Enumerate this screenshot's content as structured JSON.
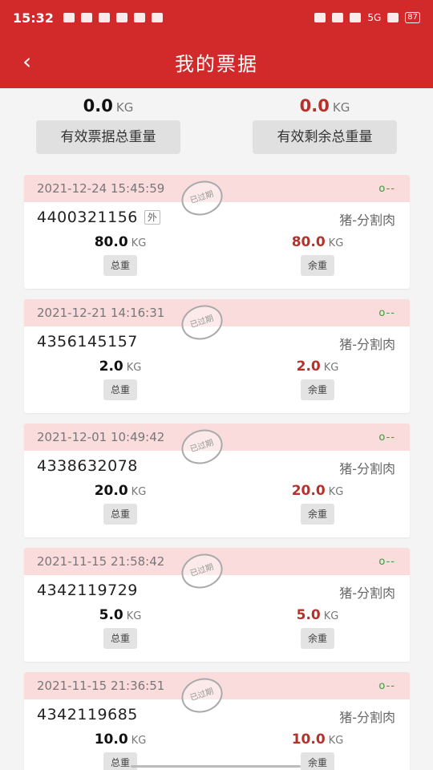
{
  "status_bar": {
    "time": "15:32",
    "signal": "5G",
    "battery": "87"
  },
  "header": {
    "title": "我的票据",
    "back_icon": "chevron-left-icon"
  },
  "summary": {
    "valid_total": {
      "value": "0.0",
      "unit": "KG",
      "label": "有效票据总重量"
    },
    "remaining_total": {
      "value": "0.0",
      "unit": "KG",
      "label": "有效剩余总重量"
    }
  },
  "cards": [
    {
      "date": "2021-12-24 15:45:59",
      "ticket": "4400321156",
      "tag": "外",
      "type": "猪-分割肉",
      "total": "80.0",
      "remaining": "80.0",
      "unit": "KG",
      "total_label": "总重",
      "remaining_label": "余重",
      "stamp": "已过期",
      "mark": "o--"
    },
    {
      "date": "2021-12-21 14:16:31",
      "ticket": "4356145157",
      "tag": "",
      "type": "猪-分割肉",
      "total": "2.0",
      "remaining": "2.0",
      "unit": "KG",
      "total_label": "总重",
      "remaining_label": "余重",
      "stamp": "已过期",
      "mark": "o--"
    },
    {
      "date": "2021-12-01 10:49:42",
      "ticket": "4338632078",
      "tag": "",
      "type": "猪-分割肉",
      "total": "20.0",
      "remaining": "20.0",
      "unit": "KG",
      "total_label": "总重",
      "remaining_label": "余重",
      "stamp": "已过期",
      "mark": "o--"
    },
    {
      "date": "2021-11-15 21:58:42",
      "ticket": "4342119729",
      "tag": "",
      "type": "猪-分割肉",
      "total": "5.0",
      "remaining": "5.0",
      "unit": "KG",
      "total_label": "总重",
      "remaining_label": "余重",
      "stamp": "已过期",
      "mark": "o--"
    },
    {
      "date": "2021-11-15 21:36:51",
      "ticket": "4342119685",
      "tag": "",
      "type": "猪-分割肉",
      "total": "10.0",
      "remaining": "10.0",
      "unit": "KG",
      "total_label": "总重",
      "remaining_label": "余重",
      "stamp": "已过期",
      "mark": "o--"
    }
  ],
  "colors": {
    "brand_red": "#d22a2a",
    "value_red": "#b8302a",
    "card_header": "#fbdcdc",
    "mark_green": "#3b9b3b"
  }
}
